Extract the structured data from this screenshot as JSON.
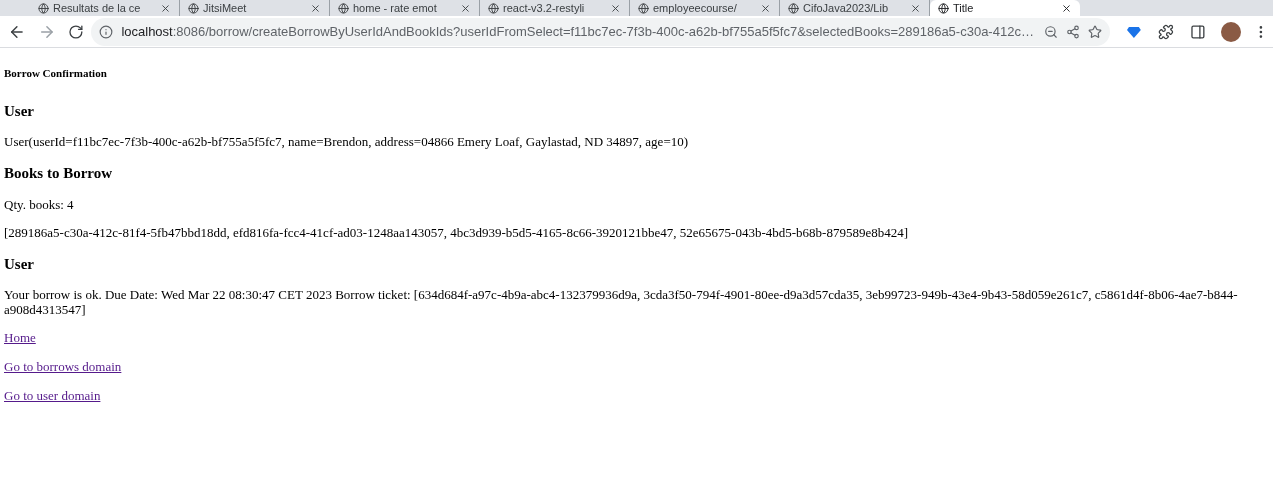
{
  "browser": {
    "tabs": [
      {
        "title": "Resultats de la ce",
        "selected": false
      },
      {
        "title": "JitsiMeet",
        "selected": false
      },
      {
        "title": "home - rate emot",
        "selected": false
      },
      {
        "title": "react-v3.2-restyli",
        "selected": false
      },
      {
        "title": "employeecourse/",
        "selected": false
      },
      {
        "title": "CifoJava2023/Lib",
        "selected": false
      },
      {
        "title": "Title",
        "selected": true
      }
    ],
    "address": {
      "host": "localhost",
      "rest": ":8086/borrow/createBorrowByUserIdAndBookIds?userIdFromSelect=f11bc7ec-7f3b-400c-a62b-bf755a5f5fc7&selectedBooks=289186a5-c30a-412c…"
    }
  },
  "page": {
    "title": "Borrow Confirmation",
    "sections": [
      {
        "heading": "User",
        "paragraphs": [
          "User(userId=f11bc7ec-7f3b-400c-a62b-bf755a5f5fc7, name=Brendon, address=04866 Emery Loaf, Gaylastad, ND 34897, age=10)"
        ]
      },
      {
        "heading": "Books to Borrow",
        "paragraphs": [
          "Qty. books: 4",
          "[289186a5-c30a-412c-81f4-5fb47bbd18dd, efd816fa-fcc4-41cf-ad03-1248aa143057, 4bc3d939-b5d5-4165-8c66-3920121bbe47, 52e65675-043b-4bd5-b68b-879589e8b424]"
        ]
      },
      {
        "heading": "User",
        "paragraphs": [
          "Your borrow is ok. Due Date: Wed Mar 22 08:30:47 CET 2023 Borrow ticket: [634d684f-a97c-4b9a-abc4-132379936d9a, 3cda3f50-794f-4901-80ee-d9a3d57cda35, 3eb99723-949b-43e4-9b43-58d059e261c7, c5861d4f-8b06-4ae7-b844-a908d4313547]"
        ]
      }
    ],
    "links": [
      "Home",
      "Go to borrows domain",
      "Go to user domain"
    ]
  }
}
